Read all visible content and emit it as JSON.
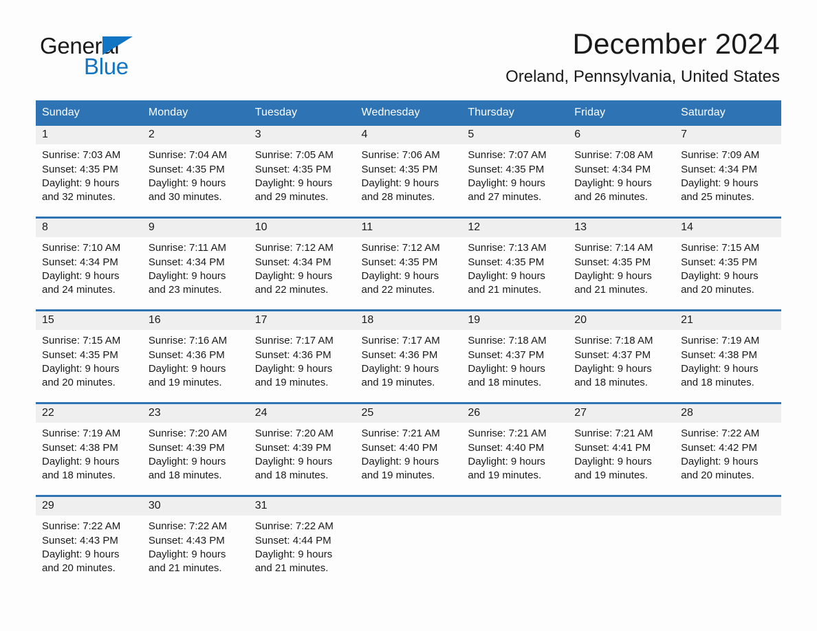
{
  "brand": {
    "name_dark": "General",
    "name_blue": "Blue",
    "triangle_color": "#1275c4"
  },
  "header": {
    "month_title": "December 2024",
    "location": "Oreland, Pennsylvania, United States",
    "header_bg": "#2e74b5",
    "daynum_bg": "#efefef"
  },
  "weekday_headers": [
    "Sunday",
    "Monday",
    "Tuesday",
    "Wednesday",
    "Thursday",
    "Friday",
    "Saturday"
  ],
  "weeks": [
    [
      {
        "day": "1",
        "sunrise": "Sunrise: 7:03 AM",
        "sunset": "Sunset: 4:35 PM",
        "daylight_1": "Daylight: 9 hours",
        "daylight_2": "and 32 minutes."
      },
      {
        "day": "2",
        "sunrise": "Sunrise: 7:04 AM",
        "sunset": "Sunset: 4:35 PM",
        "daylight_1": "Daylight: 9 hours",
        "daylight_2": "and 30 minutes."
      },
      {
        "day": "3",
        "sunrise": "Sunrise: 7:05 AM",
        "sunset": "Sunset: 4:35 PM",
        "daylight_1": "Daylight: 9 hours",
        "daylight_2": "and 29 minutes."
      },
      {
        "day": "4",
        "sunrise": "Sunrise: 7:06 AM",
        "sunset": "Sunset: 4:35 PM",
        "daylight_1": "Daylight: 9 hours",
        "daylight_2": "and 28 minutes."
      },
      {
        "day": "5",
        "sunrise": "Sunrise: 7:07 AM",
        "sunset": "Sunset: 4:35 PM",
        "daylight_1": "Daylight: 9 hours",
        "daylight_2": "and 27 minutes."
      },
      {
        "day": "6",
        "sunrise": "Sunrise: 7:08 AM",
        "sunset": "Sunset: 4:34 PM",
        "daylight_1": "Daylight: 9 hours",
        "daylight_2": "and 26 minutes."
      },
      {
        "day": "7",
        "sunrise": "Sunrise: 7:09 AM",
        "sunset": "Sunset: 4:34 PM",
        "daylight_1": "Daylight: 9 hours",
        "daylight_2": "and 25 minutes."
      }
    ],
    [
      {
        "day": "8",
        "sunrise": "Sunrise: 7:10 AM",
        "sunset": "Sunset: 4:34 PM",
        "daylight_1": "Daylight: 9 hours",
        "daylight_2": "and 24 minutes."
      },
      {
        "day": "9",
        "sunrise": "Sunrise: 7:11 AM",
        "sunset": "Sunset: 4:34 PM",
        "daylight_1": "Daylight: 9 hours",
        "daylight_2": "and 23 minutes."
      },
      {
        "day": "10",
        "sunrise": "Sunrise: 7:12 AM",
        "sunset": "Sunset: 4:34 PM",
        "daylight_1": "Daylight: 9 hours",
        "daylight_2": "and 22 minutes."
      },
      {
        "day": "11",
        "sunrise": "Sunrise: 7:12 AM",
        "sunset": "Sunset: 4:35 PM",
        "daylight_1": "Daylight: 9 hours",
        "daylight_2": "and 22 minutes."
      },
      {
        "day": "12",
        "sunrise": "Sunrise: 7:13 AM",
        "sunset": "Sunset: 4:35 PM",
        "daylight_1": "Daylight: 9 hours",
        "daylight_2": "and 21 minutes."
      },
      {
        "day": "13",
        "sunrise": "Sunrise: 7:14 AM",
        "sunset": "Sunset: 4:35 PM",
        "daylight_1": "Daylight: 9 hours",
        "daylight_2": "and 21 minutes."
      },
      {
        "day": "14",
        "sunrise": "Sunrise: 7:15 AM",
        "sunset": "Sunset: 4:35 PM",
        "daylight_1": "Daylight: 9 hours",
        "daylight_2": "and 20 minutes."
      }
    ],
    [
      {
        "day": "15",
        "sunrise": "Sunrise: 7:15 AM",
        "sunset": "Sunset: 4:35 PM",
        "daylight_1": "Daylight: 9 hours",
        "daylight_2": "and 20 minutes."
      },
      {
        "day": "16",
        "sunrise": "Sunrise: 7:16 AM",
        "sunset": "Sunset: 4:36 PM",
        "daylight_1": "Daylight: 9 hours",
        "daylight_2": "and 19 minutes."
      },
      {
        "day": "17",
        "sunrise": "Sunrise: 7:17 AM",
        "sunset": "Sunset: 4:36 PM",
        "daylight_1": "Daylight: 9 hours",
        "daylight_2": "and 19 minutes."
      },
      {
        "day": "18",
        "sunrise": "Sunrise: 7:17 AM",
        "sunset": "Sunset: 4:36 PM",
        "daylight_1": "Daylight: 9 hours",
        "daylight_2": "and 19 minutes."
      },
      {
        "day": "19",
        "sunrise": "Sunrise: 7:18 AM",
        "sunset": "Sunset: 4:37 PM",
        "daylight_1": "Daylight: 9 hours",
        "daylight_2": "and 18 minutes."
      },
      {
        "day": "20",
        "sunrise": "Sunrise: 7:18 AM",
        "sunset": "Sunset: 4:37 PM",
        "daylight_1": "Daylight: 9 hours",
        "daylight_2": "and 18 minutes."
      },
      {
        "day": "21",
        "sunrise": "Sunrise: 7:19 AM",
        "sunset": "Sunset: 4:38 PM",
        "daylight_1": "Daylight: 9 hours",
        "daylight_2": "and 18 minutes."
      }
    ],
    [
      {
        "day": "22",
        "sunrise": "Sunrise: 7:19 AM",
        "sunset": "Sunset: 4:38 PM",
        "daylight_1": "Daylight: 9 hours",
        "daylight_2": "and 18 minutes."
      },
      {
        "day": "23",
        "sunrise": "Sunrise: 7:20 AM",
        "sunset": "Sunset: 4:39 PM",
        "daylight_1": "Daylight: 9 hours",
        "daylight_2": "and 18 minutes."
      },
      {
        "day": "24",
        "sunrise": "Sunrise: 7:20 AM",
        "sunset": "Sunset: 4:39 PM",
        "daylight_1": "Daylight: 9 hours",
        "daylight_2": "and 18 minutes."
      },
      {
        "day": "25",
        "sunrise": "Sunrise: 7:21 AM",
        "sunset": "Sunset: 4:40 PM",
        "daylight_1": "Daylight: 9 hours",
        "daylight_2": "and 19 minutes."
      },
      {
        "day": "26",
        "sunrise": "Sunrise: 7:21 AM",
        "sunset": "Sunset: 4:40 PM",
        "daylight_1": "Daylight: 9 hours",
        "daylight_2": "and 19 minutes."
      },
      {
        "day": "27",
        "sunrise": "Sunrise: 7:21 AM",
        "sunset": "Sunset: 4:41 PM",
        "daylight_1": "Daylight: 9 hours",
        "daylight_2": "and 19 minutes."
      },
      {
        "day": "28",
        "sunrise": "Sunrise: 7:22 AM",
        "sunset": "Sunset: 4:42 PM",
        "daylight_1": "Daylight: 9 hours",
        "daylight_2": "and 20 minutes."
      }
    ],
    [
      {
        "day": "29",
        "sunrise": "Sunrise: 7:22 AM",
        "sunset": "Sunset: 4:43 PM",
        "daylight_1": "Daylight: 9 hours",
        "daylight_2": "and 20 minutes."
      },
      {
        "day": "30",
        "sunrise": "Sunrise: 7:22 AM",
        "sunset": "Sunset: 4:43 PM",
        "daylight_1": "Daylight: 9 hours",
        "daylight_2": "and 21 minutes."
      },
      {
        "day": "31",
        "sunrise": "Sunrise: 7:22 AM",
        "sunset": "Sunset: 4:44 PM",
        "daylight_1": "Daylight: 9 hours",
        "daylight_2": "and 21 minutes."
      },
      {
        "day": "",
        "sunrise": "",
        "sunset": "",
        "daylight_1": "",
        "daylight_2": "",
        "empty": true
      },
      {
        "day": "",
        "sunrise": "",
        "sunset": "",
        "daylight_1": "",
        "daylight_2": "",
        "empty": true
      },
      {
        "day": "",
        "sunrise": "",
        "sunset": "",
        "daylight_1": "",
        "daylight_2": "",
        "empty": true
      },
      {
        "day": "",
        "sunrise": "",
        "sunset": "",
        "daylight_1": "",
        "daylight_2": "",
        "empty": true
      }
    ]
  ]
}
